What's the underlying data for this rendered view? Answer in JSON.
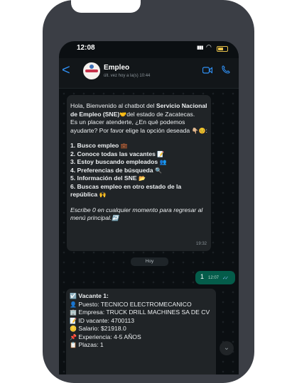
{
  "status": {
    "time": "12:08"
  },
  "header": {
    "back_label": "<",
    "name": "Empleo",
    "last_seen": "últ. vez hoy a la(s) 10:44"
  },
  "welcome": {
    "line1": "Hola, Bienvenido al chatbot del ",
    "line1_bold": "Servicio Nacional de Empleo (SNE)",
    "line1_tail": "del estado de Zacatecas.",
    "line2": "Es un placer atenderte, ¿En qué podemos ayudarte? Por favor elige la opción deseada",
    "menu": [
      "1. Busco empleo",
      "2. Conoce todas las vacantes",
      "3. Estoy buscando empleados",
      "4. Preferencias de búsqueda",
      "5. Información del SNE",
      "6. Buscas empleo en otro estado de la república"
    ],
    "hint": "Escribe 0 en cualquier momento para regresar al menú principal.",
    "time": "19:32"
  },
  "day_separator": "Hoy",
  "user_message": {
    "text": "1",
    "time": "12:07"
  },
  "vacancy": {
    "title": "Vacante 1:",
    "puesto": "Puesto: TECNICO ELECTROMECANICO",
    "empresa": "Empresa: TRUCK DRILL MACHINES SA DE CV",
    "id": "ID vacante: 4700113",
    "salario": "Salario: $21918.0",
    "experiencia": "Experiencia: 4-5 AÑOS",
    "plazas": "Plazas: 1"
  },
  "icons": {
    "emoji_menu": [
      "briefcase",
      "office-building",
      "memo",
      "people",
      "magnifier",
      "folder",
      "raised-hands"
    ],
    "vacancy": [
      "checkbox",
      "person",
      "building",
      "memo",
      "coin",
      "pin",
      "calendar"
    ]
  },
  "colors": {
    "accent": "#2f8ff3",
    "outgoing_bubble": "#045c4a",
    "incoming_bubble": "#202427",
    "background": "#0b0f12"
  }
}
